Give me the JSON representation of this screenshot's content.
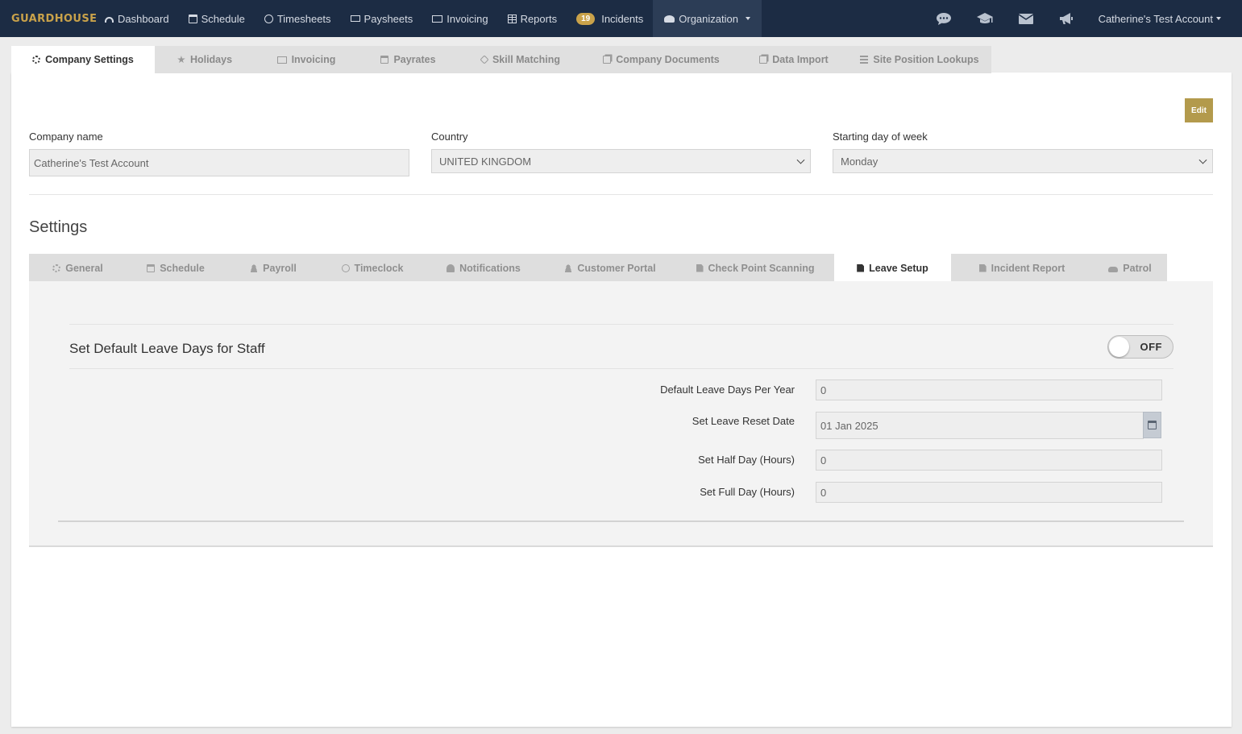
{
  "nav": {
    "brand": "GUARDHOUSE",
    "items": [
      {
        "label": "Dashboard",
        "icon": "dashboard-icon"
      },
      {
        "label": "Schedule",
        "icon": "calendar-icon"
      },
      {
        "label": "Timesheets",
        "icon": "clock-icon"
      },
      {
        "label": "Paysheets",
        "icon": "money-icon"
      },
      {
        "label": "Invoicing",
        "icon": "card-icon"
      },
      {
        "label": "Reports",
        "icon": "table-icon"
      },
      {
        "label": "Incidents",
        "badge": "19"
      },
      {
        "label": "Organization",
        "icon": "users-icon"
      }
    ],
    "account": "Catherine's Test Account"
  },
  "top_tabs": [
    {
      "label": "Company Settings",
      "active": true
    },
    {
      "label": "Holidays"
    },
    {
      "label": "Invoicing"
    },
    {
      "label": "Payrates"
    },
    {
      "label": "Skill Matching"
    },
    {
      "label": "Company Documents"
    },
    {
      "label": "Data Import"
    },
    {
      "label": "Site Position Lookups"
    }
  ],
  "company": {
    "edit_label": "Edit",
    "name_label": "Company name",
    "name_value": "Catherine's Test Account",
    "country_label": "Country",
    "country_value": "UNITED KINGDOM",
    "start_day_label": "Starting day of week",
    "start_day_value": "Monday"
  },
  "settings": {
    "title": "Settings",
    "tabs": [
      {
        "label": "General"
      },
      {
        "label": "Schedule"
      },
      {
        "label": "Payroll"
      },
      {
        "label": "Timeclock"
      },
      {
        "label": "Notifications"
      },
      {
        "label": "Customer Portal"
      },
      {
        "label": "Check Point Scanning"
      },
      {
        "label": "Leave Setup",
        "active": true
      },
      {
        "label": "Incident Report"
      },
      {
        "label": "Patrol"
      }
    ]
  },
  "leave": {
    "title": "Set Default Leave Days for Staff",
    "toggle": "OFF",
    "days_label": "Default Leave Days Per Year",
    "days_value": "0",
    "reset_label": "Set Leave Reset Date",
    "reset_value": "01 Jan 2025",
    "half_label": "Set Half Day (Hours)",
    "half_value": "0",
    "full_label": "Set Full Day (Hours)",
    "full_value": "0"
  },
  "colors": {
    "nav_bg": "#1c2c44",
    "brand": "#c9a24a",
    "edit_button": "#b39a4c"
  }
}
